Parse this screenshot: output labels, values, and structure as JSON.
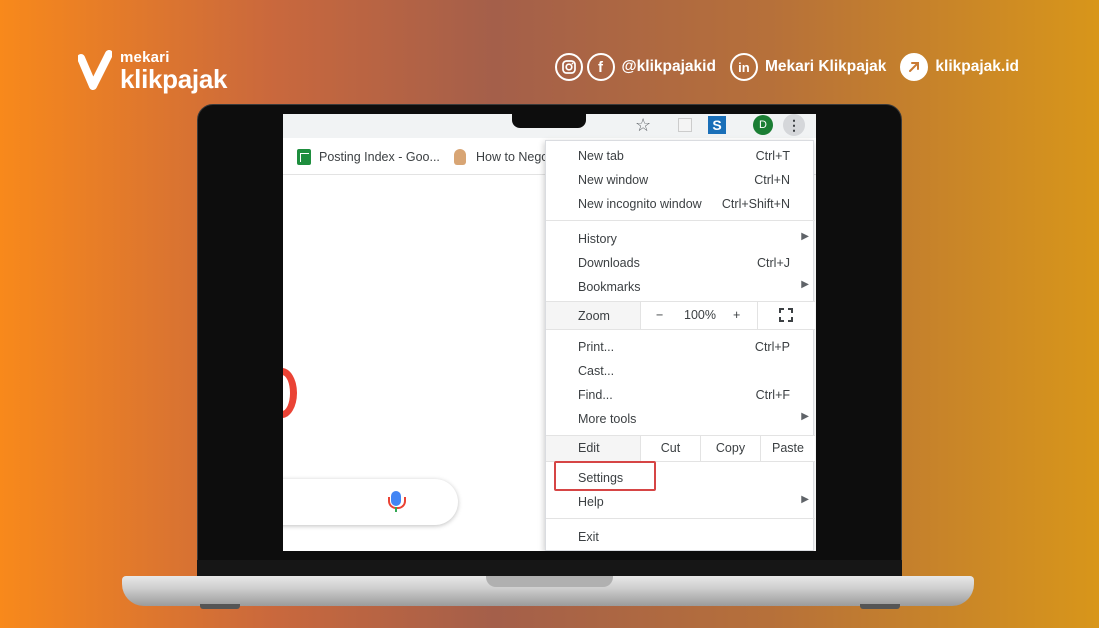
{
  "brand": {
    "mekari": "mekari",
    "name": "klikpajak"
  },
  "socials": {
    "instagram_handle": "@klikpajakid",
    "facebook_icon": "f",
    "linkedin_icon": "in",
    "linkedin_label": "Mekari Klikpajak",
    "website_label": "klikpajak.id"
  },
  "browser": {
    "avatar_initial": "D",
    "extension_letter": "S",
    "bookmarks": [
      {
        "label": "Posting Index - Goo..."
      },
      {
        "label": "How to Nego"
      }
    ]
  },
  "menu": {
    "new_tab": {
      "label": "New tab",
      "shortcut": "Ctrl+T"
    },
    "new_window": {
      "label": "New window",
      "shortcut": "Ctrl+N"
    },
    "new_incognito": {
      "label": "New incognito window",
      "shortcut": "Ctrl+Shift+N"
    },
    "history": {
      "label": "History"
    },
    "downloads": {
      "label": "Downloads",
      "shortcut": "Ctrl+J"
    },
    "bookmarks": {
      "label": "Bookmarks"
    },
    "zoom": {
      "label": "Zoom",
      "minus": "−",
      "value": "100%",
      "plus": "+"
    },
    "print": {
      "label": "Print...",
      "shortcut": "Ctrl+P"
    },
    "cast": {
      "label": "Cast..."
    },
    "find": {
      "label": "Find...",
      "shortcut": "Ctrl+F"
    },
    "more_tools": {
      "label": "More tools"
    },
    "edit": {
      "label": "Edit",
      "cut": "Cut",
      "copy": "Copy",
      "paste": "Paste"
    },
    "settings": {
      "label": "Settings"
    },
    "help": {
      "label": "Help"
    },
    "exit": {
      "label": "Exit"
    }
  },
  "colors": {
    "highlight": "#d64545",
    "avatar": "#1b7e34"
  }
}
